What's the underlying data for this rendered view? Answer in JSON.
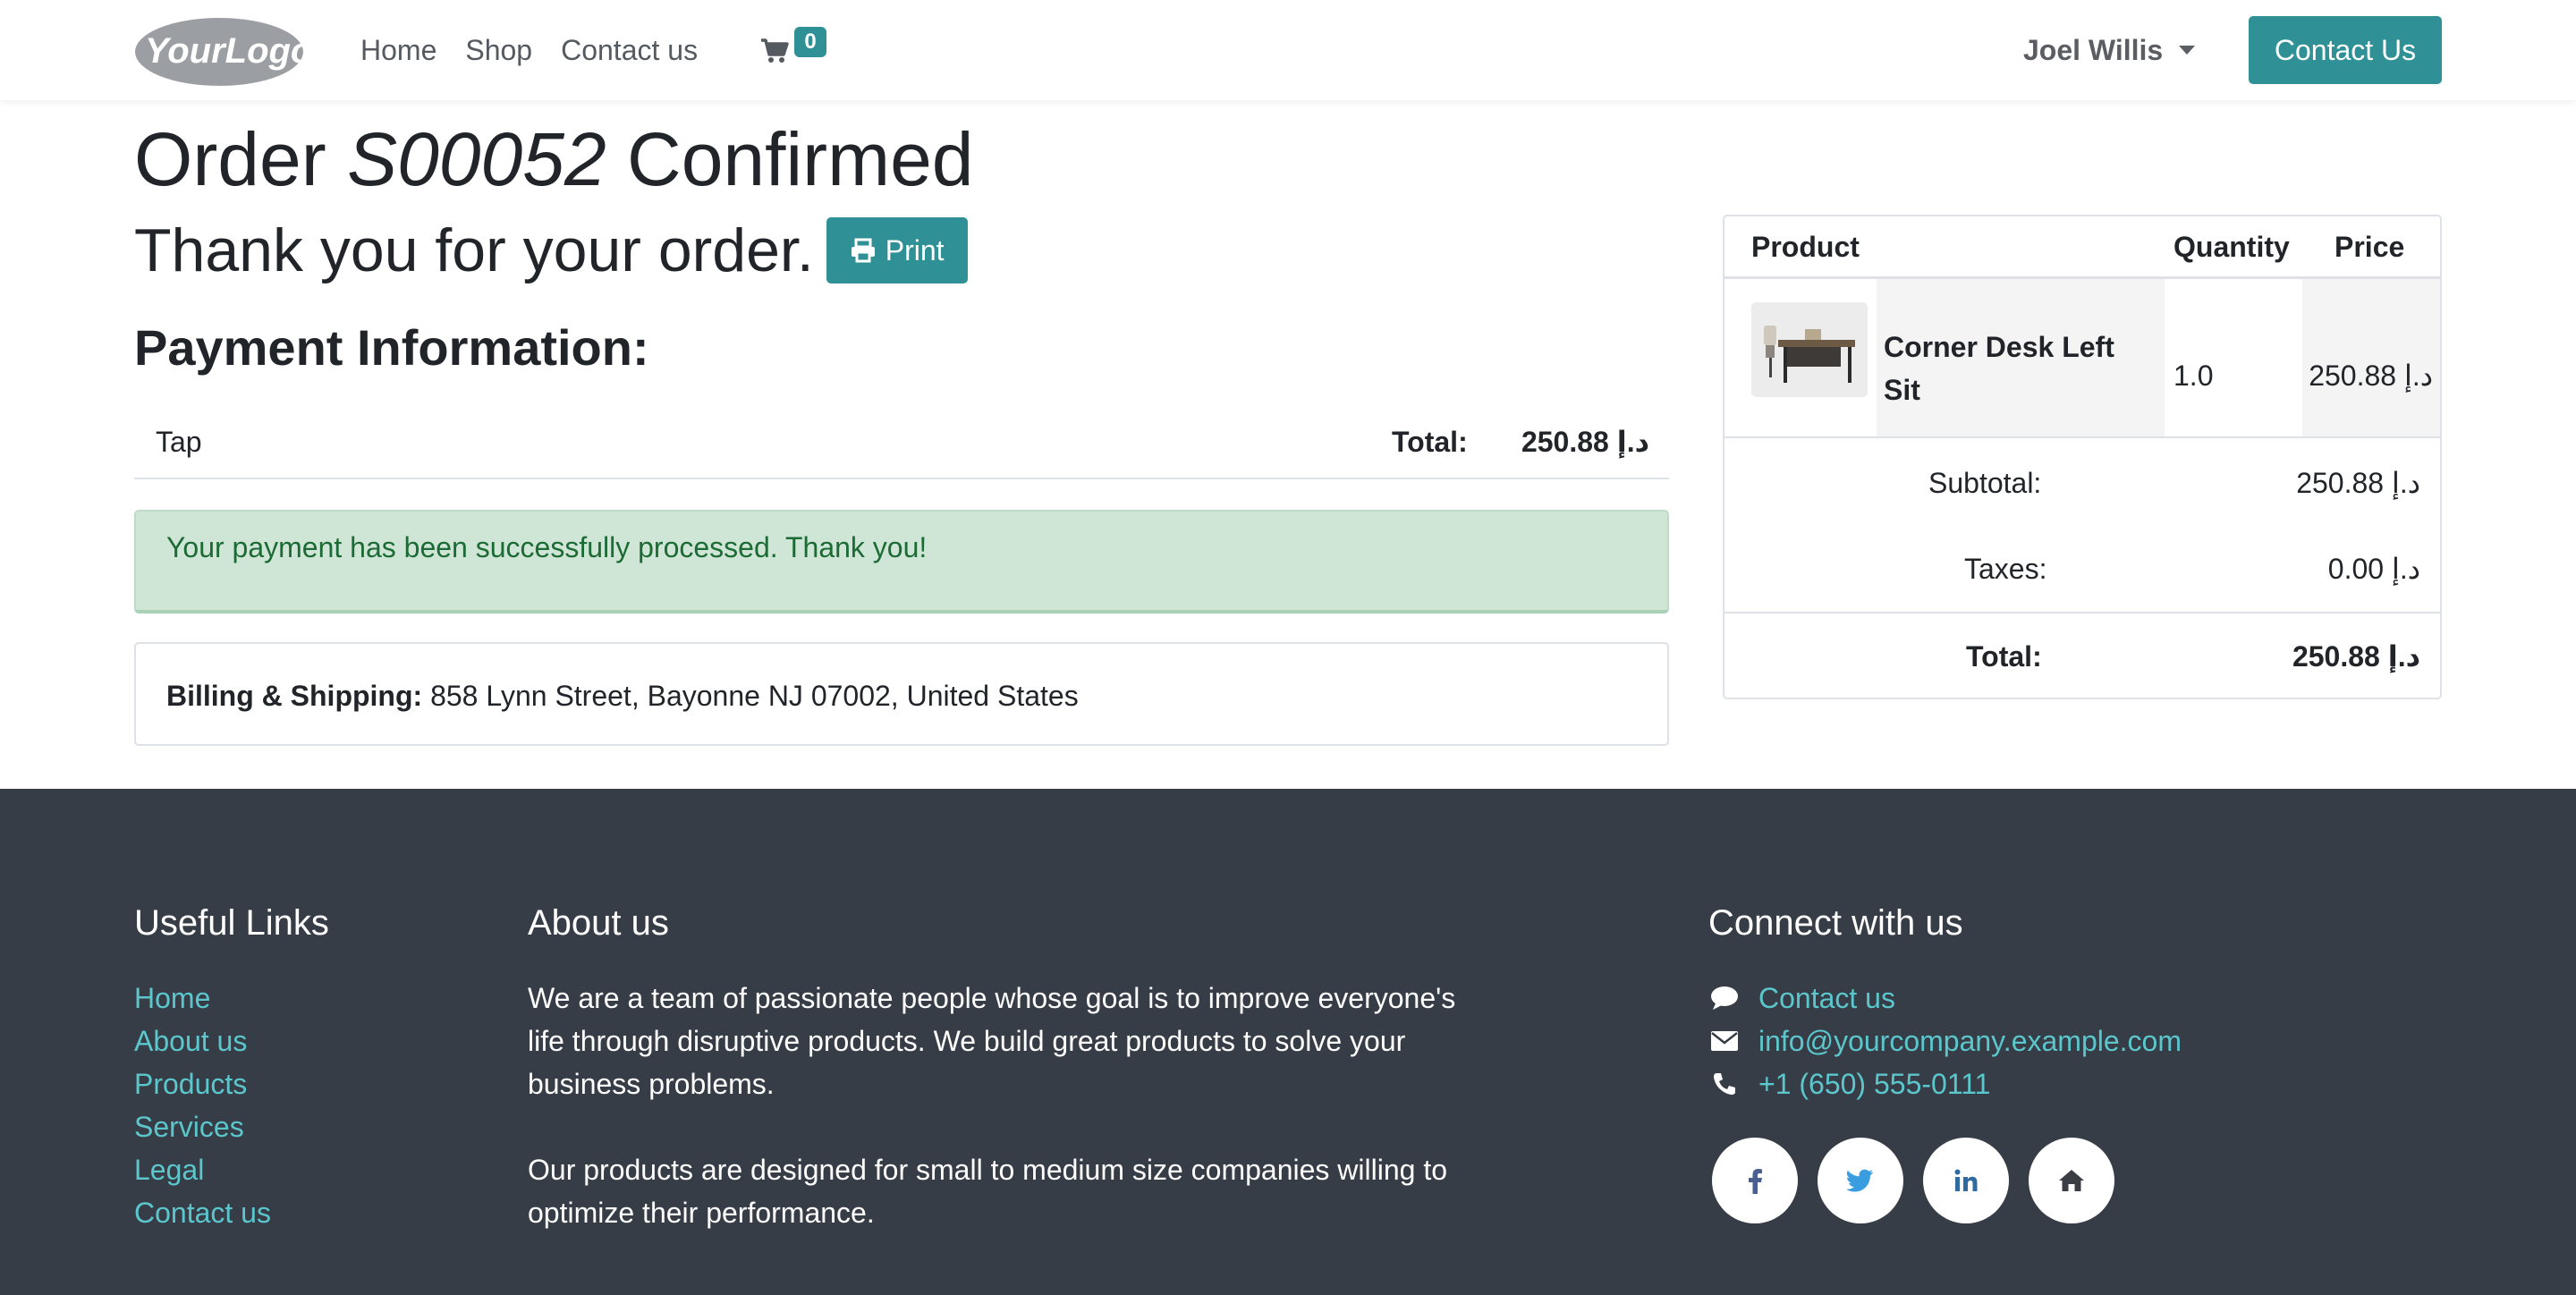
{
  "header": {
    "logo_text": "YourLogo",
    "nav": [
      "Home",
      "Shop",
      "Contact us"
    ],
    "cart_count": "0",
    "user_name": "Joel Willis",
    "contact_button": "Contact Us"
  },
  "order": {
    "title_prefix": "Order",
    "order_id": "S00052",
    "title_suffix": "Confirmed",
    "thank_you": "Thank you for your order.",
    "print_label": "Print"
  },
  "payment": {
    "heading": "Payment Information:",
    "method": "Tap",
    "total_label": "Total:",
    "total_value": "250.88 د.إ",
    "success_message": "Your payment has been successfully processed. Thank you!",
    "billing_label": "Billing & Shipping:",
    "billing_address": "858 Lynn Street, Bayonne NJ 07002, United States"
  },
  "summary": {
    "columns": [
      "Product",
      "Quantity",
      "Price"
    ],
    "items": [
      {
        "name": "Corner Desk Left Sit",
        "quantity": "1.0",
        "price": "250.88 د.إ"
      }
    ],
    "subtotal_label": "Subtotal:",
    "subtotal_value": "250.88 د.إ",
    "taxes_label": "Taxes:",
    "taxes_value": "0.00 د.إ",
    "total_label": "Total:",
    "total_value": "250.88 د.إ"
  },
  "footer": {
    "useful_links_heading": "Useful Links",
    "useful_links": [
      "Home",
      "About us",
      "Products",
      "Services",
      "Legal",
      "Contact us"
    ],
    "about_heading": "About us",
    "about_p1": "We are a team of passionate people whose goal is to improve everyone's life through disruptive products. We build great products to solve your business problems.",
    "about_p2": "Our products are designed for small to medium size companies willing to optimize their performance.",
    "connect_heading": "Connect with us",
    "contact_link": "Contact us",
    "email": "info@yourcompany.example.com",
    "phone": "+1 (650) 555-0111",
    "socials": [
      "facebook-icon",
      "twitter-icon",
      "linkedin-icon",
      "home-icon"
    ]
  },
  "colors": {
    "primary": "#2f9196",
    "footer_bg": "#373d46",
    "footer_link": "#5bc6cc",
    "success_bg": "#cfe6d7",
    "success_text": "#1c6b34"
  }
}
